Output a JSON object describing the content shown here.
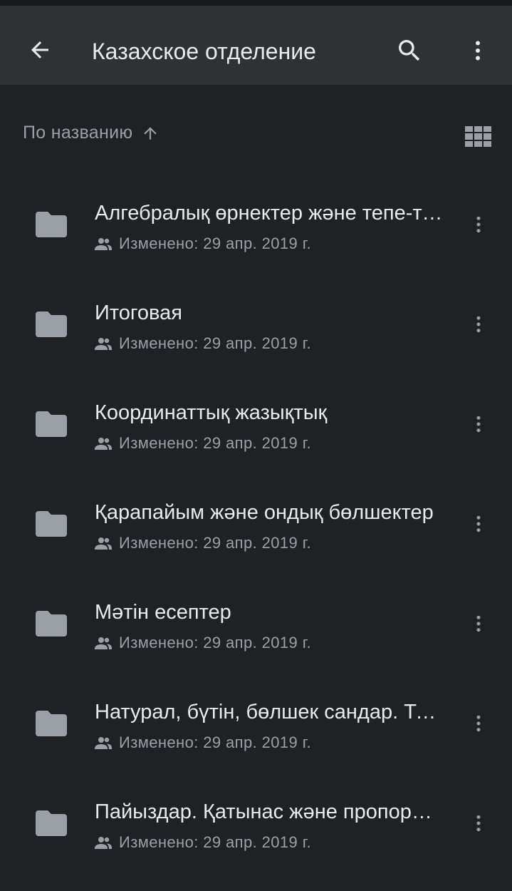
{
  "appbar": {
    "back_icon": "arrow-back-icon",
    "title": "Казахское отделение",
    "search_icon": "search-icon",
    "more_icon": "more-vert-icon"
  },
  "sort": {
    "label": "По названию",
    "direction_icon": "arrow-up-icon",
    "view_toggle_icon": "grid-view-icon"
  },
  "items": [
    {
      "name": "Алгебралық өрнектер және тепе-теңдік",
      "modified": "Изменено: 29 апр. 2019 г."
    },
    {
      "name": "Итоговая",
      "modified": "Изменено: 29 апр. 2019 г."
    },
    {
      "name": "Координаттық жазықтық",
      "modified": "Изменено: 29 апр. 2019 г."
    },
    {
      "name": "Қарапайым және ондық бөлшектер",
      "modified": "Изменено: 29 апр. 2019 г."
    },
    {
      "name": "Мәтін есептер",
      "modified": "Изменено: 29 апр. 2019 г."
    },
    {
      "name": "Натурал, бүтін, бөлшек сандар. Теңдеулер",
      "modified": "Изменено: 29 апр. 2019 г."
    },
    {
      "name": "Пайыздар. Қатынас және пропорция",
      "modified": "Изменено: 29 апр. 2019 г."
    }
  ],
  "colors": {
    "background": "#202124",
    "appbar": "#303134",
    "primary_text": "#e8eaed",
    "secondary_text": "#9aa0a6",
    "folder": "#9aa0a6"
  }
}
